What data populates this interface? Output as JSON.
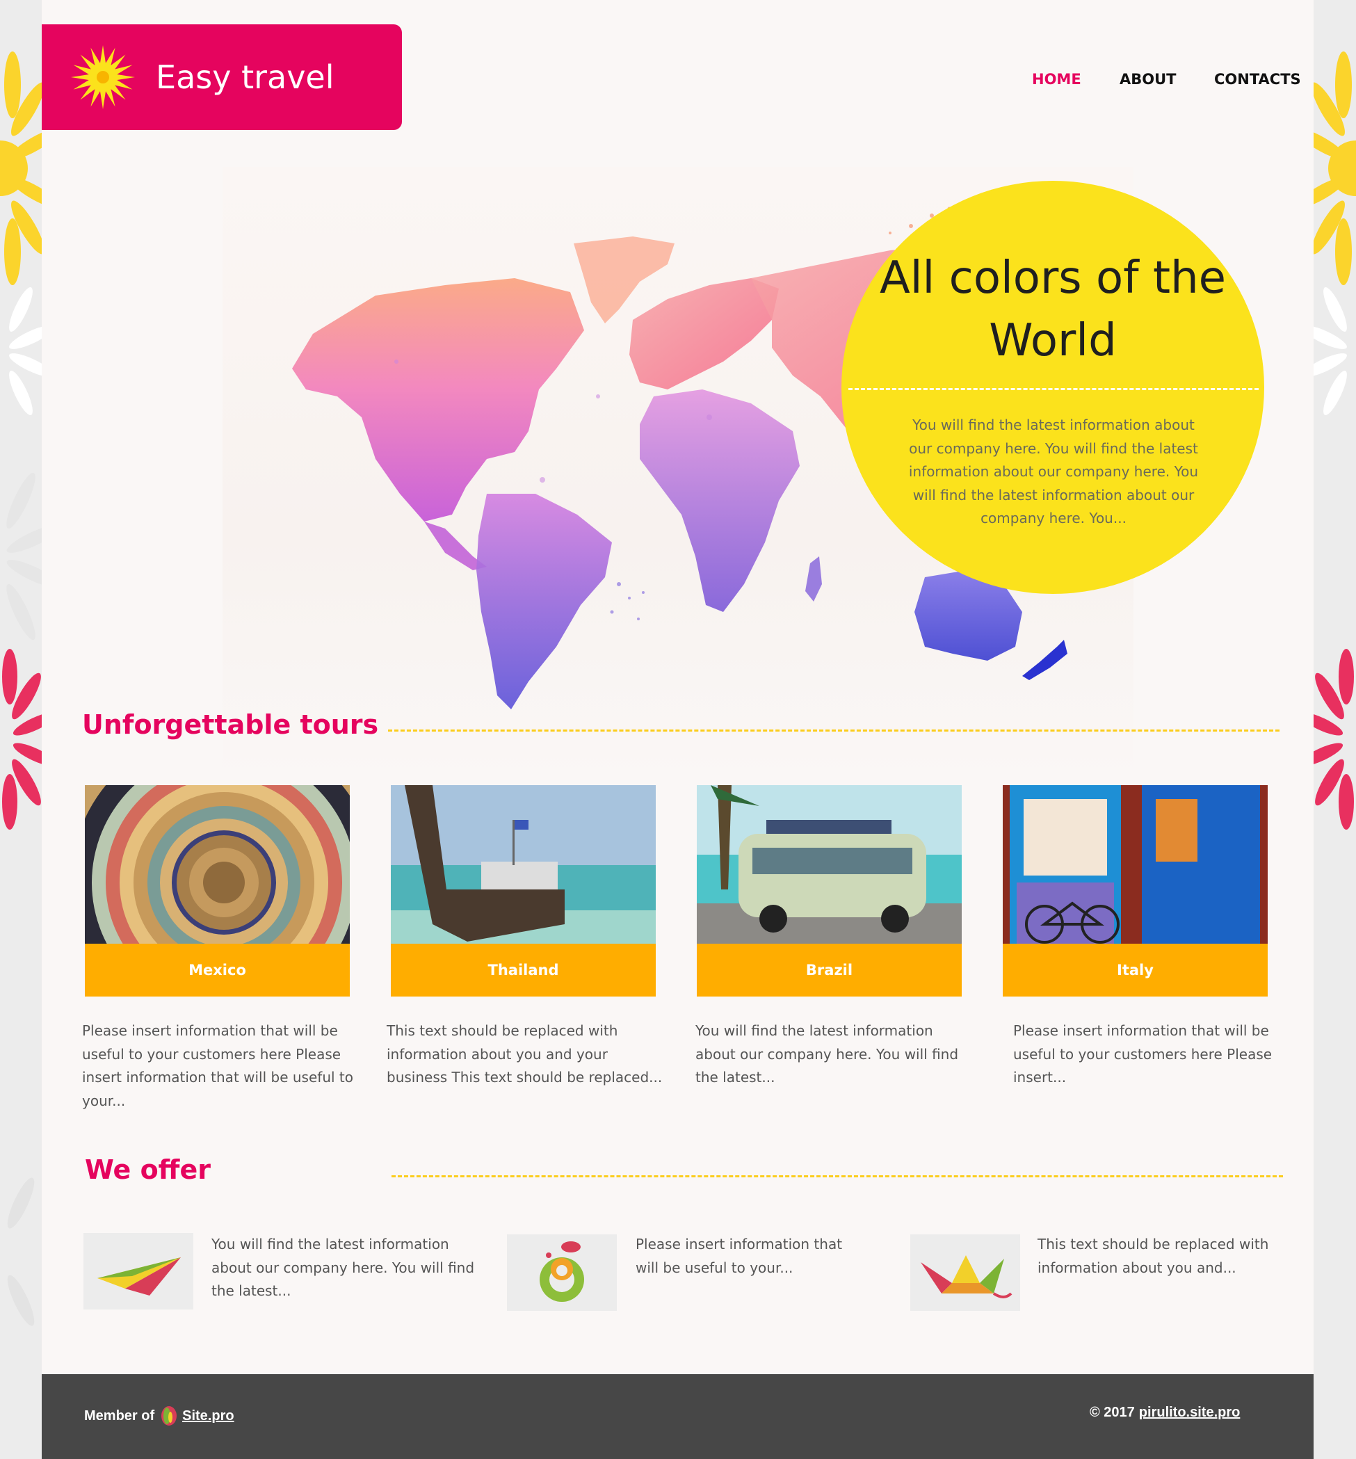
{
  "brand": {
    "name": "Easy travel",
    "color": "#e5045e"
  },
  "nav": {
    "items": [
      "HOME",
      "ABOUT",
      "CONTACTS"
    ],
    "active": "HOME"
  },
  "hero": {
    "title_line1": "All colors of the",
    "title_line2": "World",
    "text_lines": [
      "You will find the latest information about",
      "our company here. You will find the latest",
      "information about our company here. You",
      "will find the latest information about our",
      "company here. You..."
    ],
    "circle_color": "#fbe21c"
  },
  "tours": {
    "title": "Unforgettable tours",
    "items": [
      {
        "label": "Mexico",
        "lines": [
          "Please insert information that will be",
          "useful to your customers here Please",
          "insert information that will be useful to",
          "your..."
        ]
      },
      {
        "label": "Thailand",
        "lines": [
          "This text should be replaced with",
          "information about you and your",
          "business This text should be replaced..."
        ]
      },
      {
        "label": "Brazil",
        "lines": [
          "You will find the latest information",
          "about our company here. You will find",
          "the latest..."
        ]
      },
      {
        "label": "Italy",
        "lines": [
          "Please insert information that will be",
          "useful to your customers here Please",
          "insert..."
        ]
      }
    ],
    "label_color": "#ffad00"
  },
  "offers": {
    "title": "We offer",
    "items": [
      {
        "icon": "paper-plane-icon",
        "lines": [
          "You will find the latest information",
          "about our company here. You will find",
          "the latest..."
        ]
      },
      {
        "icon": "ring-icon",
        "lines": [
          "Please insert information that",
          "will be useful to your..."
        ]
      },
      {
        "icon": "paper-boat-icon",
        "lines": [
          "This text should be replaced with",
          "information about you and..."
        ]
      }
    ]
  },
  "footer": {
    "member_prefix": "Member of",
    "member_link": "Site.pro",
    "copyright": "© 2017",
    "site_link": "pirulito.site.pro",
    "bg_color": "#474747"
  }
}
